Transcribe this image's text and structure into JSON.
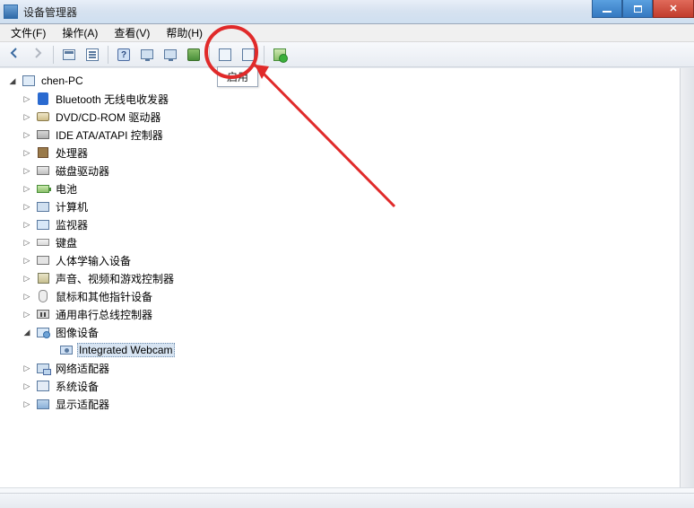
{
  "window": {
    "title": "设备管理器"
  },
  "menu": {
    "file": "文件(F)",
    "action": "操作(A)",
    "view": "查看(V)",
    "help": "帮助(H)"
  },
  "tooltip": {
    "enable": "启用"
  },
  "tree": {
    "root": "chen-PC",
    "items": [
      {
        "label": "Bluetooth 无线电收发器",
        "icon": "bt"
      },
      {
        "label": "DVD/CD-ROM 驱动器",
        "icon": "disc"
      },
      {
        "label": "IDE ATA/ATAPI 控制器",
        "icon": "ide"
      },
      {
        "label": "处理器",
        "icon": "cpu"
      },
      {
        "label": "磁盘驱动器",
        "icon": "hdd"
      },
      {
        "label": "电池",
        "icon": "bat"
      },
      {
        "label": "计算机",
        "icon": "comp"
      },
      {
        "label": "监视器",
        "icon": "mon"
      },
      {
        "label": "键盘",
        "icon": "kb"
      },
      {
        "label": "人体学输入设备",
        "icon": "hid"
      },
      {
        "label": "声音、视频和游戏控制器",
        "icon": "snd"
      },
      {
        "label": "鼠标和其他指针设备",
        "icon": "mouse"
      },
      {
        "label": "通用串行总线控制器",
        "icon": "usb"
      },
      {
        "label": "图像设备",
        "icon": "img",
        "expanded": true,
        "children": [
          {
            "label": "Integrated Webcam",
            "icon": "cam",
            "selected": true
          }
        ]
      },
      {
        "label": "网络适配器",
        "icon": "net"
      },
      {
        "label": "系统设备",
        "icon": "sys"
      },
      {
        "label": "显示适配器",
        "icon": "disp"
      }
    ]
  }
}
